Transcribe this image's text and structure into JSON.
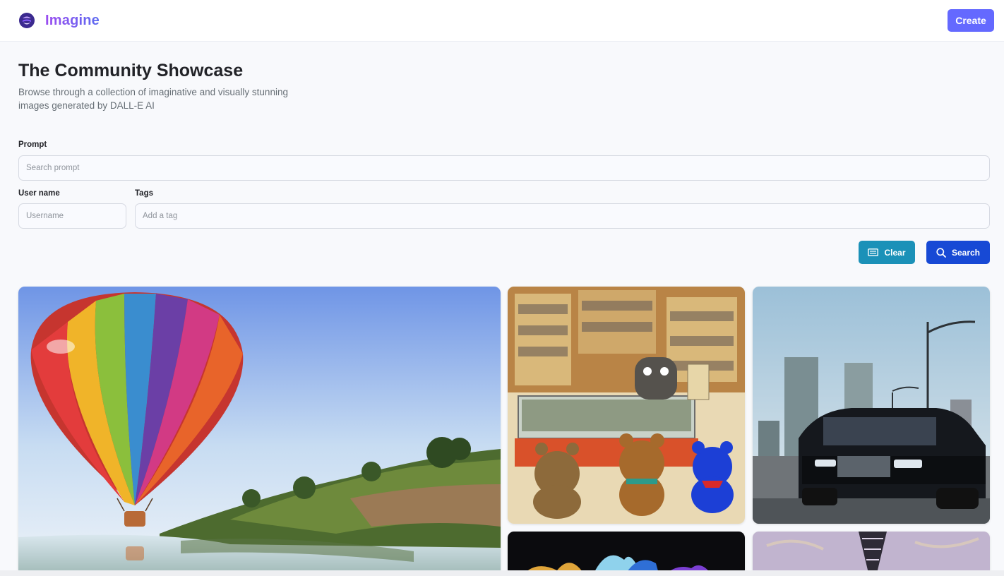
{
  "header": {
    "brand": "Imagine",
    "logo_icon": "imagine-logo-icon",
    "create_label": "Create"
  },
  "intro": {
    "title": "The Community Showcase",
    "description": "Browse through a collection of imaginative and visually stunning images generated by DALL-E AI"
  },
  "filters": {
    "prompt_label": "Prompt",
    "prompt_placeholder": "Search prompt",
    "prompt_value": "",
    "username_label": "User name",
    "username_placeholder": "Username",
    "username_value": "",
    "tags_label": "Tags",
    "tags_placeholder": "Add a tag",
    "tags_value": ""
  },
  "actions": {
    "clear_label": "Clear",
    "clear_icon": "eraser-icon",
    "search_label": "Search",
    "search_icon": "search-icon"
  },
  "colors": {
    "brand_gradient_start": "#9b4cf0",
    "brand_gradient_end": "#5d6cf0",
    "create_button": "#6469ff",
    "clear_button": "#1b91b8",
    "search_button": "#1749d5",
    "page_background": "#f8f9fc"
  },
  "gallery": {
    "items": [
      {
        "id": "hot-air-balloon",
        "subject": "hot-air-balloon"
      },
      {
        "id": "bear-shop",
        "subject": "bears-in-shop"
      },
      {
        "id": "city-car",
        "subject": "car-in-city"
      },
      {
        "id": "dark-splash",
        "subject": "colorful-splash"
      },
      {
        "id": "tower",
        "subject": "tower"
      }
    ]
  }
}
